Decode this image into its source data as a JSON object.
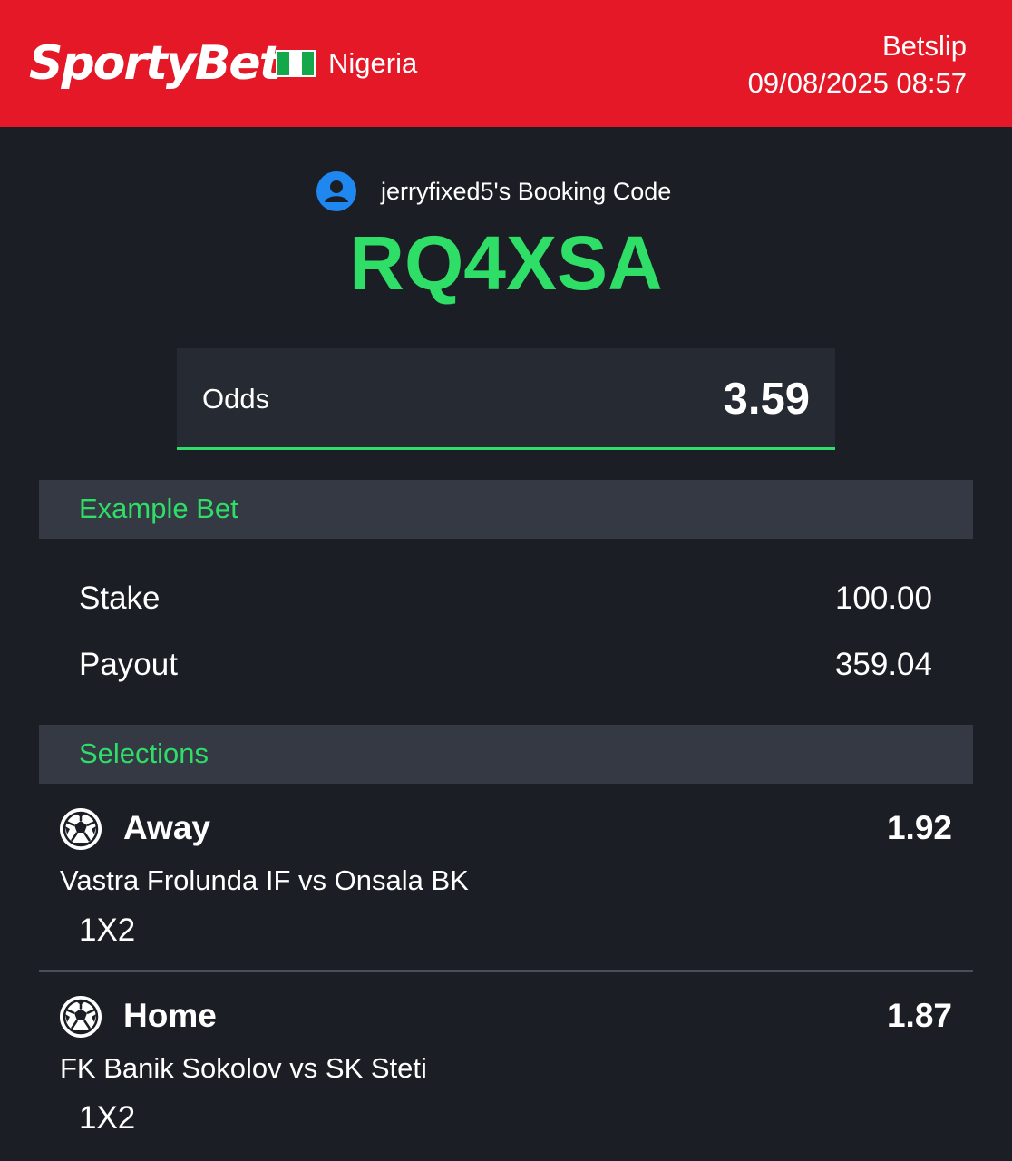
{
  "header": {
    "brand": "SportyBet",
    "country": "Nigeria",
    "title": "Betslip",
    "datetime": "09/08/2025 08:57",
    "accent_color": "#e41827"
  },
  "booking": {
    "label": "jerryfixed5's Booking Code",
    "code": "RQ4XSA",
    "icon": "user-avatar-icon",
    "code_color": "#2ede67"
  },
  "odds": {
    "label": "Odds",
    "value": "3.59"
  },
  "example_bet": {
    "title": "Example Bet",
    "stake_label": "Stake",
    "stake_value": "100.00",
    "payout_label": "Payout",
    "payout_value": "359.04"
  },
  "selections": {
    "title": "Selections",
    "items": [
      {
        "pick": "Away",
        "odds": "1.92",
        "match": "Vastra Frolunda IF vs Onsala BK",
        "market": "1X2",
        "icon": "soccer-ball-icon"
      },
      {
        "pick": "Home",
        "odds": "1.87",
        "match": "FK Banik Sokolov vs SK Steti",
        "market": "1X2",
        "icon": "soccer-ball-icon"
      }
    ]
  }
}
